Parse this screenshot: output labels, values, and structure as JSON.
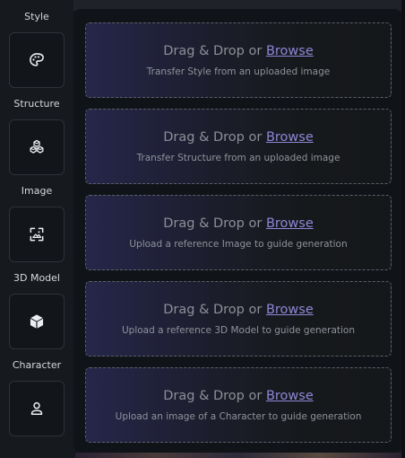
{
  "sidebar": {
    "items": [
      {
        "label": "Style",
        "icon": "palette-icon"
      },
      {
        "label": "Structure",
        "icon": "cubes-icon"
      },
      {
        "label": "Image",
        "icon": "image-frame-icon"
      },
      {
        "label": "3D Model",
        "icon": "cube-icon"
      },
      {
        "label": "Character",
        "icon": "person-icon"
      }
    ]
  },
  "dropzones": [
    {
      "prefix": "Drag & Drop or ",
      "browse": "Browse",
      "hint": "Transfer Style from an uploaded image"
    },
    {
      "prefix": "Drag & Drop or ",
      "browse": "Browse",
      "hint": "Transfer Structure from an uploaded image"
    },
    {
      "prefix": "Drag & Drop or ",
      "browse": "Browse",
      "hint": "Upload a reference Image to guide generation"
    },
    {
      "prefix": "Drag & Drop or ",
      "browse": "Browse",
      "hint": "Upload a reference 3D Model to guide generation"
    },
    {
      "prefix": "Drag & Drop or ",
      "browse": "Browse",
      "hint": "Upload an image of a Character to guide generation"
    }
  ],
  "colors": {
    "accent_link": "#8f86d6",
    "dropzone_gradient_start": "#26264a",
    "background": "#15181c"
  }
}
